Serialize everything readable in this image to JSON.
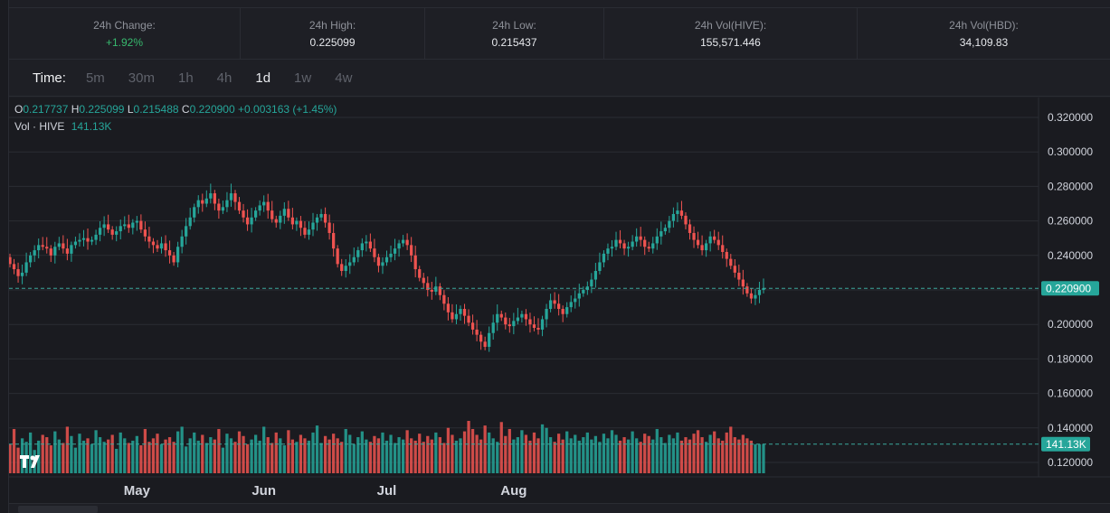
{
  "stats": [
    {
      "label": "24h Change:",
      "value": "+1.92%",
      "positive": true
    },
    {
      "label": "24h High:",
      "value": "0.225099",
      "positive": false
    },
    {
      "label": "24h Low:",
      "value": "0.215437",
      "positive": false
    },
    {
      "label": "24h Vol(HIVE):",
      "value": "155,571.446",
      "positive": false
    },
    {
      "label": "24h Vol(HBD):",
      "value": "34,109.83",
      "positive": false
    }
  ],
  "timebar": {
    "label": "Time:",
    "intervals": [
      "5m",
      "30m",
      "1h",
      "4h",
      "1d",
      "1w",
      "4w"
    ],
    "active": "1d"
  },
  "legend": {
    "o_key": "O",
    "o_val": "0.217737",
    "h_key": "H",
    "h_val": "0.225099",
    "l_key": "L",
    "l_val": "0.215488",
    "c_key": "C",
    "c_val": "0.220900",
    "change": "+0.003163 (+1.45%)",
    "vol_label": "Vol · HIVE",
    "vol_value": "141.13K"
  },
  "badges": {
    "last_price": "0.220900",
    "last_volume": "141.13K"
  },
  "colors": {
    "up": "#26a69a",
    "down": "#ef5350",
    "positive_text": "#37b96e"
  },
  "chart_data": {
    "type": "candlestick",
    "interval": "1d",
    "pair": "HIVE",
    "y_axis_ticks": [
      "0.320000",
      "0.300000",
      "0.280000",
      "0.260000",
      "0.240000",
      "0.220000",
      "0.200000",
      "0.180000",
      "0.160000",
      "0.140000",
      "0.120000"
    ],
    "y_axis_values": [
      0.32,
      0.3,
      0.28,
      0.26,
      0.24,
      0.22,
      0.2,
      0.18,
      0.16,
      0.14,
      0.12
    ],
    "ylim": [
      0.11,
      0.325
    ],
    "x_axis_labels": [
      "May",
      "Jun",
      "Jul",
      "Aug"
    ],
    "last_close": 0.2209,
    "last_volume": "141.13K",
    "close_series": [
      0.235,
      0.232,
      0.228,
      0.23,
      0.236,
      0.24,
      0.243,
      0.246,
      0.245,
      0.244,
      0.24,
      0.245,
      0.247,
      0.244,
      0.241,
      0.246,
      0.248,
      0.249,
      0.25,
      0.248,
      0.249,
      0.252,
      0.256,
      0.258,
      0.255,
      0.252,
      0.254,
      0.257,
      0.258,
      0.256,
      0.259,
      0.26,
      0.255,
      0.251,
      0.248,
      0.246,
      0.244,
      0.247,
      0.243,
      0.24,
      0.236,
      0.245,
      0.251,
      0.257,
      0.262,
      0.268,
      0.272,
      0.27,
      0.273,
      0.276,
      0.27,
      0.266,
      0.268,
      0.272,
      0.276,
      0.271,
      0.266,
      0.262,
      0.258,
      0.262,
      0.266,
      0.269,
      0.271,
      0.266,
      0.261,
      0.259,
      0.263,
      0.267,
      0.262,
      0.258,
      0.26,
      0.256,
      0.252,
      0.255,
      0.259,
      0.262,
      0.264,
      0.259,
      0.253,
      0.244,
      0.235,
      0.231,
      0.234,
      0.236,
      0.239,
      0.243,
      0.247,
      0.248,
      0.244,
      0.239,
      0.234,
      0.236,
      0.239,
      0.241,
      0.244,
      0.247,
      0.249,
      0.246,
      0.24,
      0.232,
      0.227,
      0.224,
      0.22,
      0.219,
      0.222,
      0.217,
      0.212,
      0.207,
      0.203,
      0.206,
      0.209,
      0.205,
      0.201,
      0.197,
      0.194,
      0.19,
      0.187,
      0.195,
      0.201,
      0.206,
      0.204,
      0.2,
      0.199,
      0.202,
      0.204,
      0.206,
      0.203,
      0.2,
      0.198,
      0.197,
      0.203,
      0.209,
      0.214,
      0.212,
      0.209,
      0.206,
      0.21,
      0.213,
      0.215,
      0.218,
      0.22,
      0.222,
      0.226,
      0.231,
      0.236,
      0.241,
      0.244,
      0.245,
      0.249,
      0.247,
      0.244,
      0.245,
      0.248,
      0.251,
      0.249,
      0.245,
      0.244,
      0.247,
      0.251,
      0.254,
      0.256,
      0.26,
      0.264,
      0.266,
      0.263,
      0.258,
      0.253,
      0.249,
      0.246,
      0.243,
      0.247,
      0.251,
      0.249,
      0.246,
      0.242,
      0.238,
      0.234,
      0.23,
      0.226,
      0.222,
      0.218,
      0.215,
      0.217,
      0.22,
      0.221
    ],
    "volume_series": [
      25,
      38,
      22,
      30,
      27,
      35,
      20,
      28,
      33,
      31,
      24,
      36,
      29,
      26,
      40,
      32,
      22,
      34,
      28,
      30,
      25,
      37,
      31,
      27,
      29,
      33,
      21,
      35,
      30,
      26,
      28,
      32,
      24,
      38,
      27,
      30,
      34,
      25,
      29,
      31,
      27,
      36,
      40,
      23,
      30,
      35,
      28,
      33,
      26,
      31,
      29,
      38,
      22,
      34,
      30,
      27,
      36,
      32,
      25,
      29,
      33,
      28,
      40,
      31,
      26,
      35,
      30,
      24,
      37,
      29,
      27,
      33,
      30,
      28,
      35,
      41,
      26,
      32,
      29,
      34,
      30,
      27,
      38,
      33,
      25,
      31,
      36,
      29,
      27,
      32,
      30,
      35,
      28,
      33,
      26,
      31,
      29,
      37,
      30,
      28,
      34,
      27,
      32,
      29,
      35,
      31,
      26,
      39,
      33,
      28,
      30,
      36,
      45,
      38,
      33,
      29,
      41,
      35,
      30,
      27,
      44,
      32,
      38,
      29,
      31,
      37,
      33,
      28,
      35,
      30,
      42,
      39,
      31,
      27,
      34,
      29,
      36,
      30,
      33,
      28,
      31,
      35,
      29,
      32,
      27,
      34,
      30,
      37,
      33,
      28,
      31,
      29,
      36,
      30,
      27,
      34,
      32,
      29,
      38,
      31,
      26,
      33,
      30,
      35,
      28,
      31,
      29,
      34,
      37,
      31,
      27,
      33,
      36,
      30,
      28,
      35,
      40,
      31,
      29,
      33,
      30,
      28
    ]
  }
}
